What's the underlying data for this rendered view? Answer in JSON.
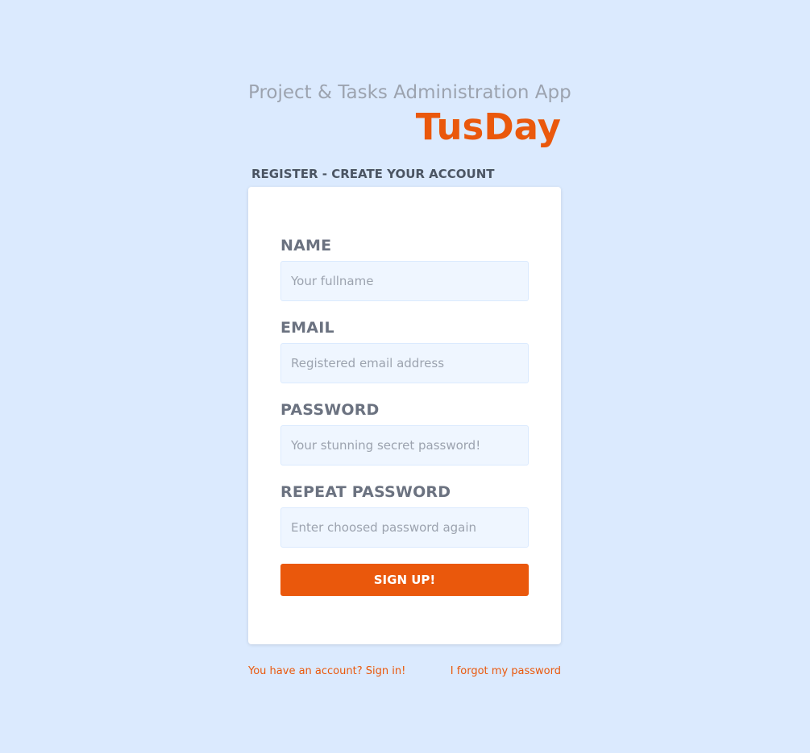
{
  "header": {
    "subtitle": "Project & Tasks Administration App",
    "brand": "TusDay"
  },
  "form": {
    "heading": "REGISTER - CREATE YOUR ACCOUNT",
    "fields": [
      {
        "label": "NAME",
        "placeholder": "Your fullname",
        "value": ""
      },
      {
        "label": "EMAIL",
        "placeholder": "Registered email address",
        "value": ""
      },
      {
        "label": "PASSWORD",
        "placeholder": "Your stunning secret password!",
        "value": ""
      },
      {
        "label": "REPEAT PASSWORD",
        "placeholder": "Enter choosed password again",
        "value": ""
      }
    ],
    "submit_label": "SIGN UP!"
  },
  "links": {
    "sign_in": "You have an account? Sign in!",
    "forgot": "I forgot my password"
  },
  "colors": {
    "background": "#dbeafe",
    "accent": "#ea580c",
    "label": "#6b7280",
    "input_bg": "#eff6ff"
  }
}
